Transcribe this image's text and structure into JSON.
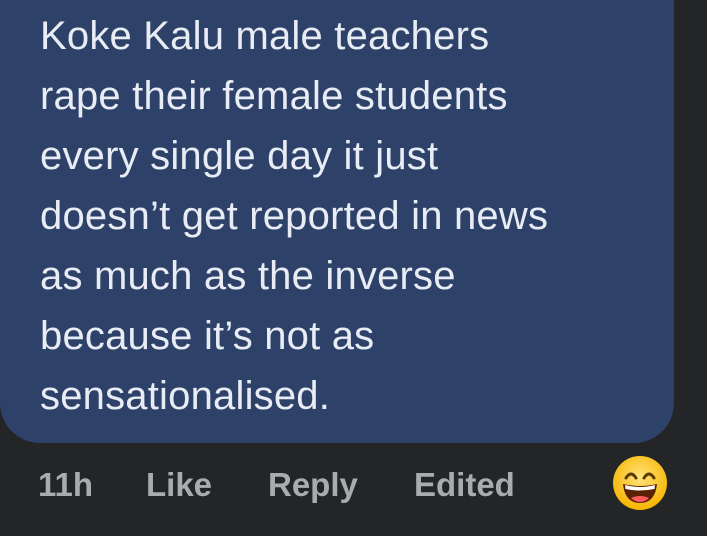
{
  "comment": {
    "lines": [
      "Koke Kalu male teachers",
      "rape their female students",
      "every single day it just",
      "doesn’t get reported in news",
      "as much as the inverse",
      "because it’s not as",
      "sensationalised."
    ]
  },
  "actions": {
    "time": "11h",
    "like": "Like",
    "reply": "Reply",
    "edited": "Edited"
  },
  "reaction": {
    "icon": "grinning-face-emoji-icon"
  },
  "colors": {
    "background": "#242526",
    "bubble": "#2e4168",
    "text": "#e8ecf4",
    "meta": "#a8abaf"
  }
}
